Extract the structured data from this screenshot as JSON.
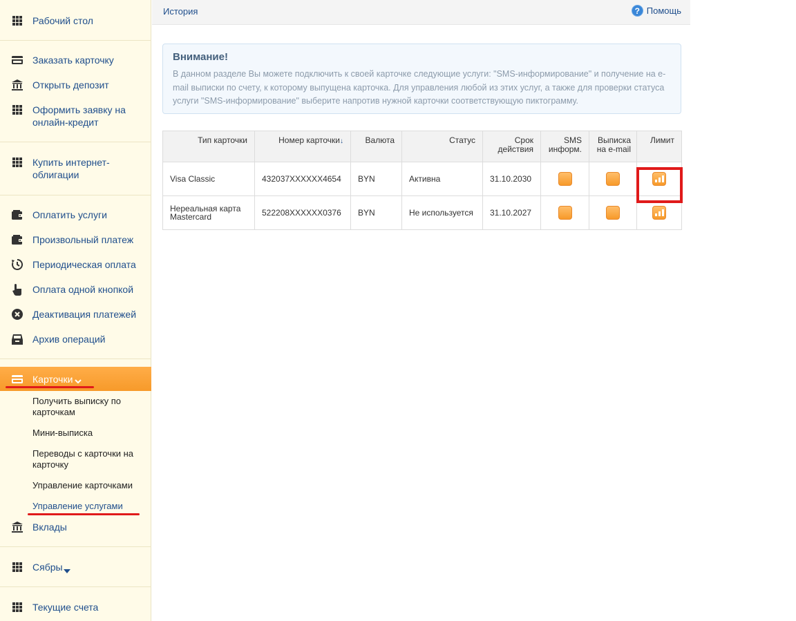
{
  "sidebar": {
    "items": [
      {
        "label": "Рабочий стол",
        "icon": "grid-icon"
      },
      {
        "label": "Заказать карточку",
        "icon": "card-icon"
      },
      {
        "label": "Открыть депозит",
        "icon": "bank-icon"
      },
      {
        "label": "Оформить заявку на онлайн-кредит",
        "icon": "grid-icon"
      },
      {
        "label": "Купить интернет-облигации",
        "icon": "grid-icon"
      },
      {
        "label": "Оплатить услуги",
        "icon": "wallet-icon"
      },
      {
        "label": "Произвольный платеж",
        "icon": "wallet-icon"
      },
      {
        "label": "Периодическая оплата",
        "icon": "history-icon"
      },
      {
        "label": "Оплата одной кнопкой",
        "icon": "pointer-hand-icon"
      },
      {
        "label": "Деактивация платежей",
        "icon": "close-circle-icon"
      },
      {
        "label": "Архив операций",
        "icon": "archive-icon"
      },
      {
        "label": "Карточки",
        "icon": "card-icon"
      },
      {
        "label": "Вклады",
        "icon": "bank-icon"
      },
      {
        "label": "Сябры",
        "icon": "grid-icon"
      },
      {
        "label": "Текущие счета",
        "icon": "grid-icon"
      }
    ],
    "cards_submenu": [
      "Получить выписку по карточкам",
      "Мини-выписка",
      "Переводы с карточки на карточку",
      "Управление карточками",
      "Управление услугами"
    ]
  },
  "topbar": {
    "history": "История",
    "help": "Помощь"
  },
  "notice": {
    "title": "Внимание!",
    "text": "В данном разделе Вы можете подключить к своей карточке следующие услуги: \"SMS-информирование\" и получение на e-mail выписки по счету, к которому выпущена карточка. Для управления любой из этих услуг, а также для проверки статуса услуги \"SMS-информирование\" выберите напротив нужной карточки соответствующую пиктограмму."
  },
  "table": {
    "headers": [
      "Тип карточки",
      "Номер карточки",
      "Валюта",
      "Статус",
      "Срок действия",
      "SMS информ.",
      "Выписка на e-mail",
      "Лимит"
    ],
    "sort_arrow": "↓",
    "rows": [
      {
        "type": "Visa Classic",
        "number": "432037XXXXXX4654",
        "currency": "BYN",
        "status": "Активна",
        "expiry": "31.10.2030"
      },
      {
        "type": "Нереальная карта Mastercard",
        "number": "522208XXXXXX0376",
        "currency": "BYN",
        "status": "Не используется",
        "expiry": "31.10.2027"
      }
    ]
  },
  "colors": {
    "accent": "#f79a2a",
    "link": "#1f4e8c",
    "highlight": "#e01a1a"
  }
}
